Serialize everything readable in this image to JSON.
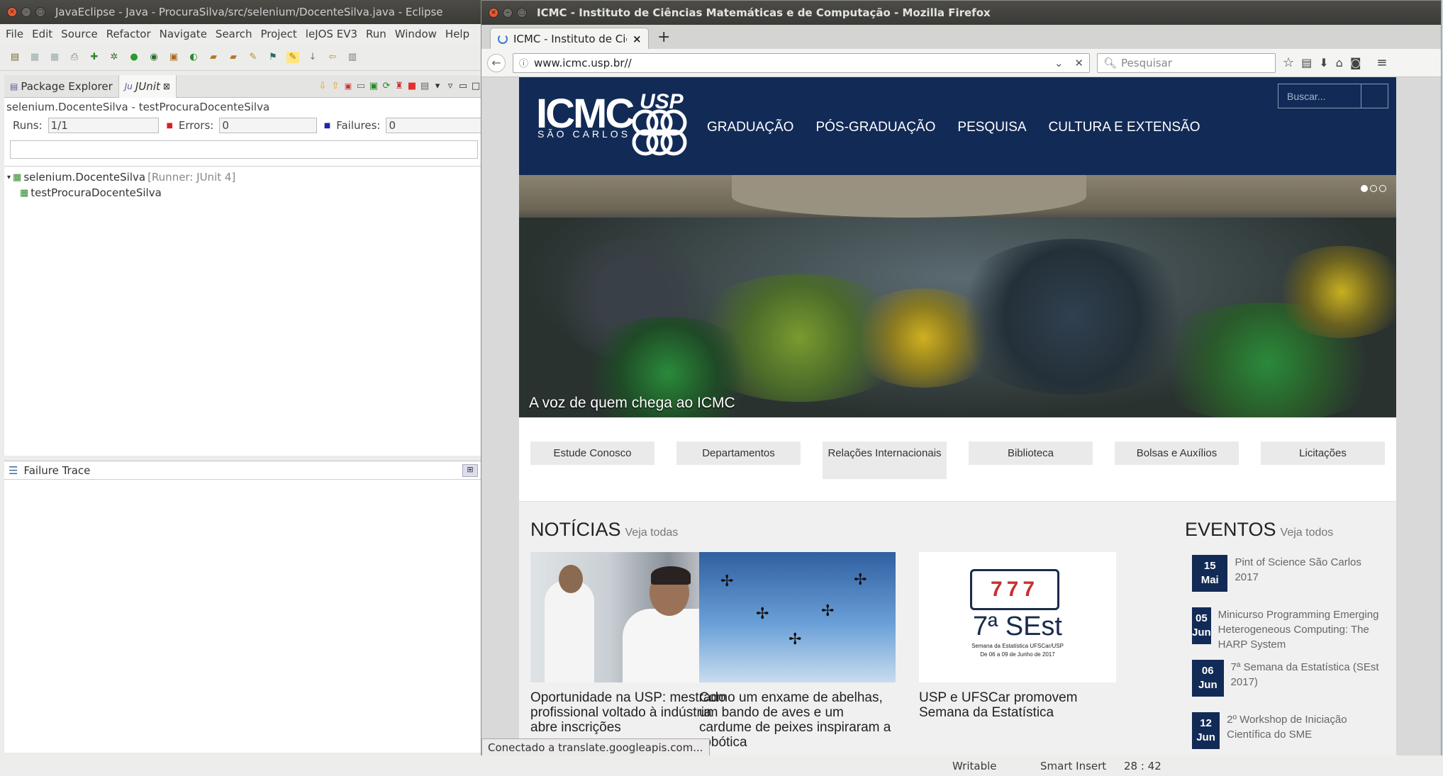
{
  "eclipse": {
    "title": "JavaEclipse - Java - ProcuraSilva/src/selenium/DocenteSilva.java - Eclipse",
    "menu": [
      "File",
      "Edit",
      "Source",
      "Refactor",
      "Navigate",
      "Search",
      "Project",
      "leJOS EV3",
      "Run",
      "Window",
      "Help"
    ],
    "tabs": {
      "package_explorer": "Package Explorer",
      "junit": "JUnit"
    },
    "junit": {
      "header": "selenium.DocenteSilva - testProcuraDocenteSilva",
      "runs_label": "Runs:",
      "runs_value": "1/1",
      "errors_label": "Errors:",
      "errors_value": "0",
      "failures_label": "Failures:",
      "failures_value": "0",
      "tree_root": "selenium.DocenteSilva",
      "tree_root_runner": "[Runner: JUnit 4]",
      "tree_child": "testProcuraDocenteSilva",
      "progress_color": "#5cb85c"
    },
    "failure_trace": "Failure Trace",
    "status": {
      "writable": "Writable",
      "insert": "Smart Insert",
      "position": "28 : 42"
    }
  },
  "firefox": {
    "title": "ICMC - Instituto de Ciências Matemáticas e de Computação - Mozilla Firefox",
    "tab_title": "ICMC - Instituto de Ciê",
    "url": "www.icmc.usp.br//",
    "search_placeholder": "Pesquisar",
    "status_text": "Conectado a translate.googleapis.com..."
  },
  "site": {
    "logo_main": "ICMC",
    "logo_usp": "USP",
    "logo_sub": "SÃO CARLOS",
    "nav": [
      "GRADUAÇÃO",
      "PÓS-GRADUAÇÃO",
      "PESQUISA",
      "CULTURA E EXTENSÃO"
    ],
    "search_placeholder": "Buscar...",
    "hero_caption": "A voz de quem chega ao ICMC",
    "quick_links": [
      "Estude Conosco",
      "Departamentos",
      "Relações Internacionais",
      "Biblioteca",
      "Bolsas e Auxílios",
      "Licitações"
    ],
    "news_heading": "NOTÍCIAS",
    "news_link": "Veja todas",
    "news": [
      {
        "title": "Oportunidade na USP: mestrado profissional voltado à indústria abre inscrições"
      },
      {
        "title": "Como um enxame de abelhas, um bando de aves e um cardume de peixes inspiraram a robótica"
      },
      {
        "title": "USP e UFSCar promovem Semana da Estatística",
        "poster_big": "7ª SEst",
        "poster_small": "Semana da Estatística UFSCar/USP",
        "poster_dates": "De 06 a 09 de Junho de 2017",
        "slot": "777"
      }
    ],
    "events_heading": "EVENTOS",
    "events_link": "Veja todos",
    "events": [
      {
        "day": "15",
        "month": "Mai",
        "title": "Pint of Science São Carlos 2017"
      },
      {
        "day": "05",
        "month": "Jun",
        "title": "Minicurso Programming Emerging Heterogeneous Computing: The HARP System"
      },
      {
        "day": "06",
        "month": "Jun",
        "title": "7ª Semana da Estatística (SEst 2017)"
      },
      {
        "day": "12",
        "month": "Jun",
        "title": "2º Workshop de Iniciação Científica do SME"
      }
    ],
    "brand_color": "#122a56"
  }
}
